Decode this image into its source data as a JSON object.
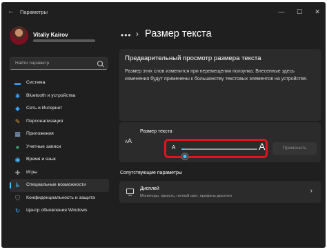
{
  "window": {
    "title": "Параметры",
    "back_glyph": "←",
    "controls": {
      "minimize": "—",
      "maximize": "☐",
      "close": "✕"
    }
  },
  "profile": {
    "name": "Vitaliy Kairov"
  },
  "search": {
    "placeholder": "Найти параметр"
  },
  "sidebar": {
    "items": [
      {
        "label": "Система",
        "icon": "system-icon",
        "glyph": "▬",
        "color": "#3b9cf0"
      },
      {
        "label": "Bluetooth и устройства",
        "icon": "bluetooth-icon",
        "glyph": "✱",
        "color": "#3b9cf0"
      },
      {
        "label": "Сеть и Интернет",
        "icon": "wifi-icon",
        "glyph": "◆",
        "color": "#3b9cf0"
      },
      {
        "label": "Персонализация",
        "icon": "brush-icon",
        "glyph": "✎",
        "color": "#e0a040"
      },
      {
        "label": "Приложения",
        "icon": "apps-icon",
        "glyph": "▦",
        "color": "#8cb0d8"
      },
      {
        "label": "Учетные записи",
        "icon": "account-icon",
        "glyph": "●",
        "color": "#40b070"
      },
      {
        "label": "Время и язык",
        "icon": "globe-icon",
        "glyph": "◉",
        "color": "#4cc2ff"
      },
      {
        "label": "Игры",
        "icon": "gamepad-icon",
        "glyph": "✚",
        "color": "#9a9a9a"
      },
      {
        "label": "Специальные возможности",
        "icon": "accessibility-icon",
        "glyph": "♿",
        "color": "#4cc2ff",
        "active": true
      },
      {
        "label": "Конфиденциальность и защита",
        "icon": "shield-icon",
        "glyph": "⛉",
        "color": "#9a9a9a"
      },
      {
        "label": "Центр обновления Windows",
        "icon": "update-icon",
        "glyph": "↻",
        "color": "#3b9cf0"
      }
    ]
  },
  "breadcrumb": {
    "dots": "•••",
    "separator": "›",
    "title": "Размер текста"
  },
  "preview": {
    "title": "Предварительный просмотр размера текста",
    "body": "Размер этих слов изменится при перемещении ползунка. Внесенные здесь изменения будут применены к большинству текстовых элементов на устройстве."
  },
  "text_size": {
    "icon_big": "A",
    "icon_small": "A",
    "label": "Размер текста",
    "small_a": "A",
    "big_a": "A",
    "value_percent": 100,
    "min_percent": 100,
    "max_percent": 225,
    "apply_label": "Применить",
    "highlight_color": "#e0141d",
    "accent_color": "#4cc2ff"
  },
  "related": {
    "title": "Сопутствующие параметры",
    "item_title": "Дисплей",
    "item_subtitle": "Мониторы, яркость, ночной свет, профиль дисплея",
    "chevron": "›"
  }
}
